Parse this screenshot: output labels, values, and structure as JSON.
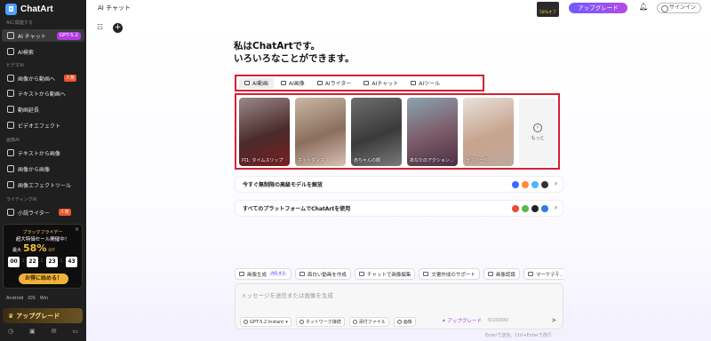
{
  "app": {
    "name": "ChatArt"
  },
  "sidebar": {
    "sections": {
      "ai_related": "AIに関連する",
      "video_ai": "ビデオAI",
      "image_ai": "画像AI",
      "writing_ai": "ライティングAI"
    },
    "items": [
      {
        "label": "AI チャット",
        "badge": "GPT-5.2"
      },
      {
        "label": "AI検索"
      },
      {
        "label": "画像から動画へ",
        "badge": "人気"
      },
      {
        "label": "テキストから動画へ"
      },
      {
        "label": "動画延長"
      },
      {
        "label": "ビデオエフェクト"
      },
      {
        "label": "テキストから画像"
      },
      {
        "label": "画像から画像"
      },
      {
        "label": "画像エフェクトツール"
      },
      {
        "label": "小説ライター",
        "badge": "人気"
      }
    ],
    "promo": {
      "line1": "ブラックフライデー",
      "line2": "超大特価セール開催中！",
      "line3_prefix": "最大",
      "percent": "58%",
      "off": "OFF",
      "countdown": [
        "00",
        "22",
        "23",
        "43"
      ],
      "button": "お得に始める！",
      "close": "×"
    },
    "platforms": [
      "Android",
      "iOS",
      "Win"
    ],
    "upgrade": "アップグレード"
  },
  "topbar": {
    "title": "AI チャット",
    "discount": "58%オフ",
    "upgrade": "アップグレード",
    "signin": "サインイン"
  },
  "main": {
    "heading_line1": "私はChatArtです。",
    "heading_line2": "いろいろなことができます。",
    "tabs": [
      {
        "label": "AI動画",
        "active": true
      },
      {
        "label": "AI画像"
      },
      {
        "label": "AIライター"
      },
      {
        "label": "AIチャット"
      },
      {
        "label": "AIツール"
      }
    ],
    "gallery": [
      {
        "caption": "円1: タイムスリップ"
      },
      {
        "caption": "ホットダンス"
      },
      {
        "caption": "赤ちゃんの顔"
      },
      {
        "caption": "あなたのアクション..."
      },
      {
        "caption": "ラブバード"
      }
    ],
    "more": "もっと",
    "promo_rows": [
      {
        "text": "今すぐ無制限の高級モデルを解放"
      },
      {
        "text": "すべてのプラットフォームでChatArtを使用"
      }
    ]
  },
  "chips": [
    {
      "label": "画像生成",
      "badge": "AIE 4.1"
    },
    {
      "label": "面白い動画を作成"
    },
    {
      "label": "チャットで画像編集"
    },
    {
      "label": "文書作成のサポート"
    },
    {
      "label": "画像認識"
    },
    {
      "label": "マーケティ..."
    }
  ],
  "composer": {
    "placeholder": "メッセージを送信または画像を生成",
    "model": "GPT-5.2 Instant",
    "network": "ネットワーク接続",
    "attach": "添付ファイル",
    "image": "画像",
    "upgrade": "アップグレード",
    "count": "0/20000",
    "hint": "Enterで送信、Ctrl+Enterで改行"
  }
}
